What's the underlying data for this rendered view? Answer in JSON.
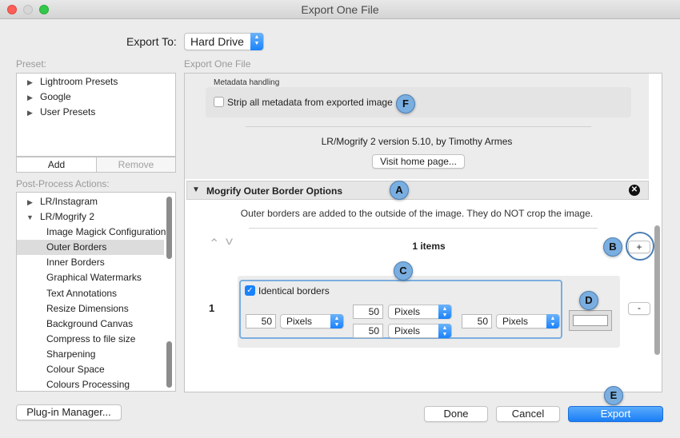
{
  "window": {
    "title": "Export One File"
  },
  "export_to": {
    "label": "Export To:",
    "value": "Hard Drive"
  },
  "preset": {
    "label": "Preset:",
    "items": [
      "Lightroom Presets",
      "Google",
      "User Presets"
    ],
    "add_label": "Add",
    "remove_label": "Remove"
  },
  "post_process": {
    "label": "Post-Process Actions:",
    "items": [
      "LR/Instagram",
      "LR/Mogrify 2",
      "Image Magick Configuration",
      "Outer Borders",
      "Inner Borders",
      "Graphical Watermarks",
      "Text Annotations",
      "Resize Dimensions",
      "Background Canvas",
      "Compress to file size",
      "Sharpening",
      "Colour Space",
      "Colours Processing"
    ],
    "selected": "Outer Borders"
  },
  "main": {
    "section_label": "Export One File",
    "metadata_title": "Metadata handling",
    "strip_metadata_label": "Strip all metadata from exported image",
    "version_text": "LR/Mogrify 2 version 5.10, by Timothy Armes",
    "home_button": "Visit home page...",
    "border_section_title": "Mogrify Outer Border Options",
    "border_description": "Outer borders are added to the outside of the image.  They do NOT crop the image.",
    "items_count": "1 items",
    "add_item": "+",
    "remove_item": "-",
    "row_number": "1",
    "identical_label": "Identical borders",
    "left_value": "50",
    "left_unit": "Pixels",
    "top_value": "50",
    "top_unit": "Pixels",
    "bottom_value": "50",
    "bottom_unit": "Pixels",
    "right_value": "50",
    "right_unit": "Pixels"
  },
  "callouts": [
    "A",
    "B",
    "C",
    "D",
    "E",
    "F"
  ],
  "footer": {
    "plugin_manager": "Plug-in Manager...",
    "done": "Done",
    "cancel": "Cancel",
    "export": "Export"
  },
  "colors": {
    "accent": "#1a82fb",
    "callout": "#7aaee0"
  }
}
